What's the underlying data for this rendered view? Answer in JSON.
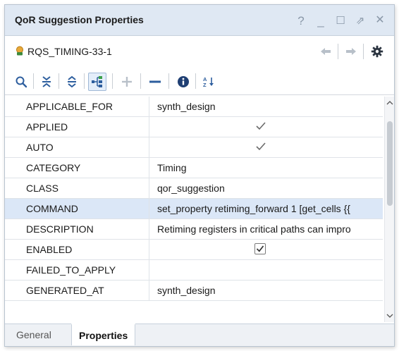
{
  "window": {
    "title": "QoR Suggestion Properties",
    "controls": {
      "help": "?",
      "minimize": "_",
      "maximize": "☐",
      "restore": "⇗",
      "close": "✕"
    }
  },
  "object": {
    "icon": "qor-suggestion-icon",
    "name": "RQS_TIMING-33-1"
  },
  "toolbar": {
    "icons": [
      "search-icon",
      "collapse-all-icon",
      "expand-all-icon",
      "group-by-category-icon",
      "add-icon",
      "remove-icon",
      "info-icon",
      "sort-icon"
    ],
    "add_label": "+",
    "remove_label": "—",
    "sort_label": "AZ"
  },
  "properties": [
    {
      "name": "APPLICABLE_FOR",
      "value": "synth_design",
      "type": "text",
      "selected": false
    },
    {
      "name": "APPLIED",
      "value": "",
      "type": "check",
      "selected": false
    },
    {
      "name": "AUTO",
      "value": "",
      "type": "check",
      "selected": false
    },
    {
      "name": "CATEGORY",
      "value": "Timing",
      "type": "text",
      "selected": false
    },
    {
      "name": "CLASS",
      "value": "qor_suggestion",
      "type": "text",
      "selected": false
    },
    {
      "name": "COMMAND",
      "value": "set_property retiming_forward 1 [get_cells {{",
      "type": "text",
      "selected": true
    },
    {
      "name": "DESCRIPTION",
      "value": "Retiming registers in critical paths can impro",
      "type": "text",
      "selected": false
    },
    {
      "name": "ENABLED",
      "value": "",
      "type": "checkbox",
      "selected": false
    },
    {
      "name": "FAILED_TO_APPLY",
      "value": "",
      "type": "text",
      "selected": false
    },
    {
      "name": "GENERATED_AT",
      "value": "synth_design",
      "type": "text",
      "selected": false
    }
  ],
  "tabs": [
    {
      "label": "General",
      "active": false
    },
    {
      "label": "Properties",
      "active": true
    }
  ],
  "colors": {
    "titlebar": "#dfe8f3",
    "selected_row": "#dbe7f7",
    "accent_icon": "#2d5e9e"
  }
}
